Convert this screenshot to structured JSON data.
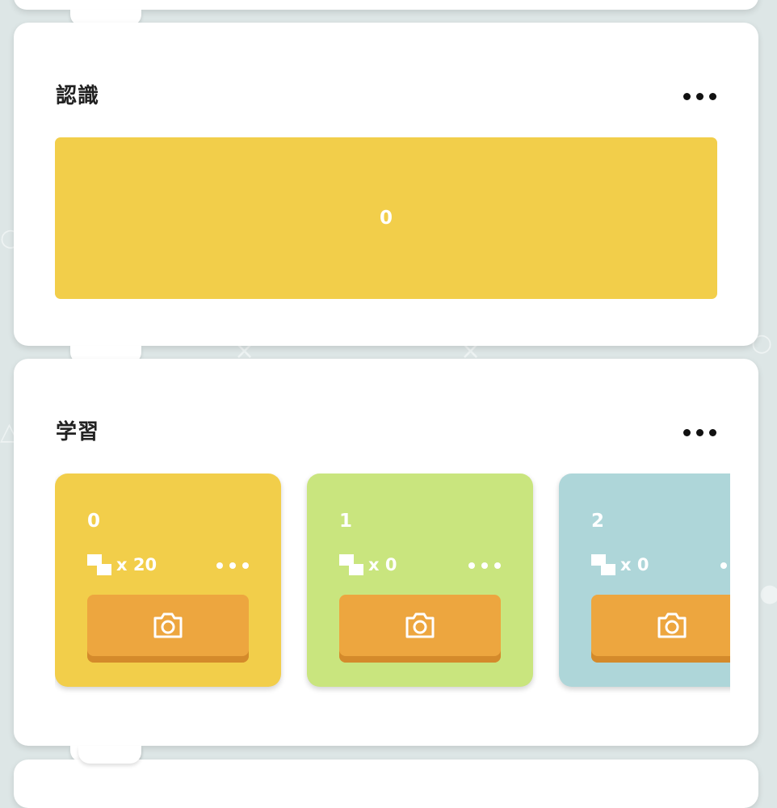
{
  "recognition": {
    "title": "認識",
    "value": "0"
  },
  "learning": {
    "title": "学習",
    "classes": [
      {
        "name": "0",
        "count": "x 20",
        "color": "#f2ce4a"
      },
      {
        "name": "1",
        "count": "x 0",
        "color": "#c9e57e"
      },
      {
        "name": "2",
        "count": "x 0",
        "color": "#aed6d9"
      }
    ]
  },
  "icons": {
    "more": "more-dots-icon",
    "samples": "image-stack-icon",
    "camera": "camera-icon"
  },
  "colors": {
    "background": "#dde6e6",
    "capture_button": "#eda63f"
  }
}
